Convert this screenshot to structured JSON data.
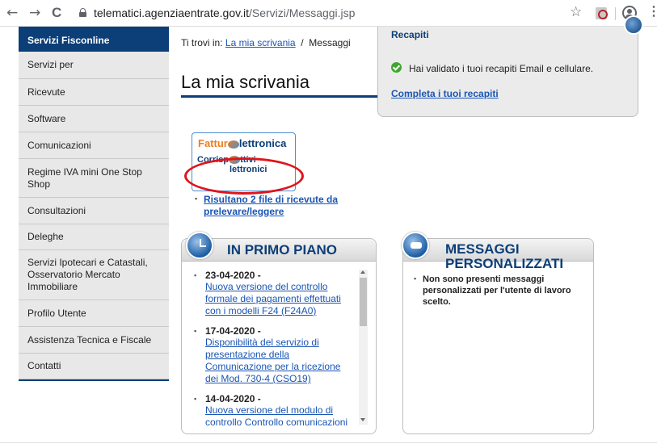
{
  "browser": {
    "back_glyph": "←",
    "forward_glyph": "→",
    "reload_glyph": "C",
    "url_host": "telematici.agenziaentrate.gov.it",
    "url_path": "/Servizi/Messaggi.jsp",
    "star_glyph": "☆",
    "menu_glyph": "⋮"
  },
  "sidebar": {
    "header": "Servizi Fisconline",
    "items": [
      {
        "label": "Servizi per"
      },
      {
        "label": "Ricevute"
      },
      {
        "label": "Software"
      },
      {
        "label": "Comunicazioni"
      },
      {
        "label": "Regime IVA mini One Stop Shop"
      },
      {
        "label": "Consultazioni"
      },
      {
        "label": "Deleghe"
      },
      {
        "label": "Servizi Ipotecari e Catastali, Osservatorio Mercato Immobiliare"
      },
      {
        "label": "Profilo Utente"
      },
      {
        "label": "Assistenza Tecnica e Fiscale"
      },
      {
        "label": "Contatti"
      }
    ]
  },
  "breadcrumb": {
    "prefix": "Ti trovi in:",
    "link": "La mia scrivania",
    "separator": "/",
    "current": "Messaggi"
  },
  "page_title": "La mia scrivania",
  "recapiti": {
    "title": "Recapiti",
    "message": "Hai validato i tuoi recapiti Email e cellulare.",
    "link": "Completa i tuoi recapiti"
  },
  "fattura_logo": {
    "line1_a": "Fattur",
    "line1_b": "lettronica",
    "line2_a": "Corrisp",
    "line2_b": "ttivi",
    "line3": "lettronici"
  },
  "ricevute_link": "Risultano 2 file di ricevute da prelevare/leggere",
  "primo_piano": {
    "title": "IN PRIMO PIANO",
    "items": [
      {
        "date": "23-04-2020 -",
        "text": "Nuova versione del controllo formale dei pagamenti effettuati con i modelli F24 (F24A0)"
      },
      {
        "date": "17-04-2020 -",
        "text": "Disponibilità del servizio di presentazione della Comunicazione per la ricezione dei Mod. 730-4 (CSO19)"
      },
      {
        "date": "14-04-2020 -",
        "text": "Nuova versione del modulo di controllo Controllo comunicazioni"
      }
    ]
  },
  "messaggi": {
    "title_line1": "MESSAGGI",
    "title_line2": "PERSONALIZZATI",
    "text": "Non sono presenti messaggi personalizzati per l'utente di lavoro scelto."
  },
  "bullet_glyph": "▪",
  "colors": {
    "brand_navy": "#0c3e78",
    "link_blue": "#1a55b4",
    "highlight_red": "#e0141c",
    "check_green": "#3fa62f"
  }
}
